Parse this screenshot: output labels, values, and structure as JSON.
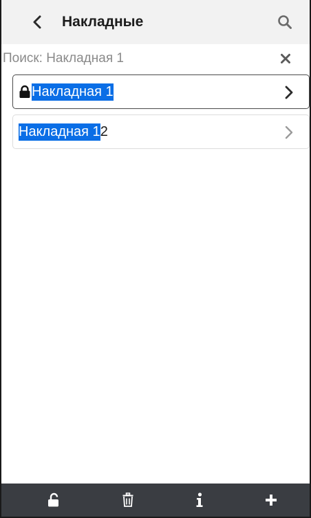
{
  "header": {
    "title": "Накладные",
    "back_icon": "chevron-left-icon",
    "search_icon": "search-icon"
  },
  "search": {
    "text": "Поиск: Накладная 1",
    "clear_icon": "close-icon"
  },
  "list": {
    "items": [
      {
        "highlight": "Накладная 1",
        "rest": "",
        "locked": true,
        "selected": true
      },
      {
        "highlight": "Накладная 1",
        "rest": "2",
        "locked": false,
        "selected": false
      }
    ]
  },
  "bottombar": {
    "buttons": [
      "unlock-icon",
      "trash-icon",
      "info-icon",
      "plus-icon"
    ]
  },
  "colors": {
    "highlight": "#0a6ee6",
    "header_bg": "#f2f2f2",
    "bottombar_bg": "#3a3d42"
  }
}
